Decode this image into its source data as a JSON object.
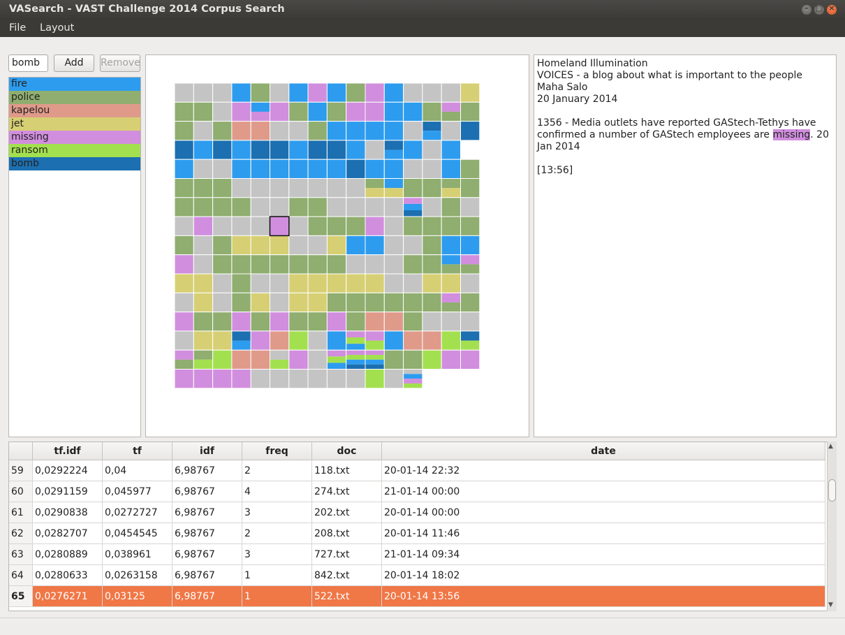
{
  "window": {
    "title": "VASearch - VAST Challenge 2014 Corpus Search"
  },
  "menu": [
    {
      "label": "File"
    },
    {
      "label": "Layout"
    }
  ],
  "search": {
    "value": "bomb"
  },
  "buttons": {
    "add": "Add",
    "remove": "Remove"
  },
  "terms": [
    {
      "label": "fire",
      "color": "#2d9cee"
    },
    {
      "label": "police",
      "color": "#8fae6f"
    },
    {
      "label": "kapelou",
      "color": "#e09a8a"
    },
    {
      "label": "jet",
      "color": "#d7cf73"
    },
    {
      "label": "missing",
      "color": "#d18ede"
    },
    {
      "label": "ransom",
      "color": "#a3e04f"
    },
    {
      "label": "bomb",
      "color": "#1c6fb0"
    }
  ],
  "doc_panel": {
    "line1": "Homeland Illumination",
    "line2": "VOICES - a blog about what is important to the people",
    "line3": "Maha Salo",
    "line4": "20 January 2014",
    "body_before": "1356 - Media outlets have reported GAStech-Tethys have confirmed a number of GAStech employees are ",
    "body_highlight": "missing",
    "body_after": ". 20 Jan 2014",
    "time": "[13:56]"
  },
  "table": {
    "columns": [
      "tf.idf",
      "tf",
      "idf",
      "freq",
      "doc",
      "date"
    ],
    "rows": [
      {
        "n": "59",
        "tfidf": "0,0292224",
        "tf": "0,04",
        "idf": "6,98767",
        "freq": "2",
        "doc": "118.txt",
        "date": "20-01-14 22:32"
      },
      {
        "n": "60",
        "tfidf": "0,0291159",
        "tf": "0,045977",
        "idf": "6,98767",
        "freq": "4",
        "doc": "274.txt",
        "date": "21-01-14 00:00"
      },
      {
        "n": "61",
        "tfidf": "0,0290838",
        "tf": "0,0272727",
        "idf": "6,98767",
        "freq": "3",
        "doc": "202.txt",
        "date": "20-01-14 00:00"
      },
      {
        "n": "62",
        "tfidf": "0,0282707",
        "tf": "0,0454545",
        "idf": "6,98767",
        "freq": "2",
        "doc": "208.txt",
        "date": "20-01-14 11:46"
      },
      {
        "n": "63",
        "tfidf": "0,0280889",
        "tf": "0,038961",
        "idf": "6,98767",
        "freq": "3",
        "doc": "727.txt",
        "date": "21-01-14 09:34"
      },
      {
        "n": "64",
        "tfidf": "0,0280633",
        "tf": "0,0263158",
        "idf": "6,98767",
        "freq": "1",
        "doc": "842.txt",
        "date": "20-01-14 18:02"
      },
      {
        "n": "65",
        "tfidf": "0,0276271",
        "tf": "0,03125",
        "idf": "6,98767",
        "freq": "1",
        "doc": "522.txt",
        "date": "20-01-14 13:56",
        "selected": true
      }
    ]
  },
  "grid_colors": {
    "gray": "#c4c4c4",
    "fire": "#2d9cee",
    "police": "#8fae6f",
    "kapelou": "#e09a8a",
    "jet": "#d7cf73",
    "missing": "#d18ede",
    "ransom": "#a3e04f",
    "bomb": "#1c6fb0"
  },
  "grid": {
    "selected_cell": [
      7,
      5
    ],
    "rows": [
      "g g g f p g f m f p m f g g g j",
      "p p g m f/m m p f p m m f f p m/p p",
      "p g p k k g g p f f f f g b/f g b",
      "b f b f b b f b b f g b/f f g f",
      "f g g f f f f f f b f f g g f p",
      "p p p g g g g g g g p/j f/j p p p/j p",
      "p p p p g g p p g g g g m/f/b g p g",
      "g m g g g m g p p p m g p p p p",
      "p g p j j j g g j f f g g p f f",
      "m g p p p p p p p g g g p p f/p m/p",
      "j j g p g g j j j j j g g j j g",
      "g j g p j g j j p p p p p p m/p p",
      "m p p m p m p p m p k k p g g g",
      "g j j b/f m k r g f m/r/f m/r f k k r b/r",
      "m/p p/r r k k g/r m g m/r/f m/r/f/b m/r/f/b p p r m m",
      "m m m m g g g g g g r g g/f/m/r"
    ]
  }
}
